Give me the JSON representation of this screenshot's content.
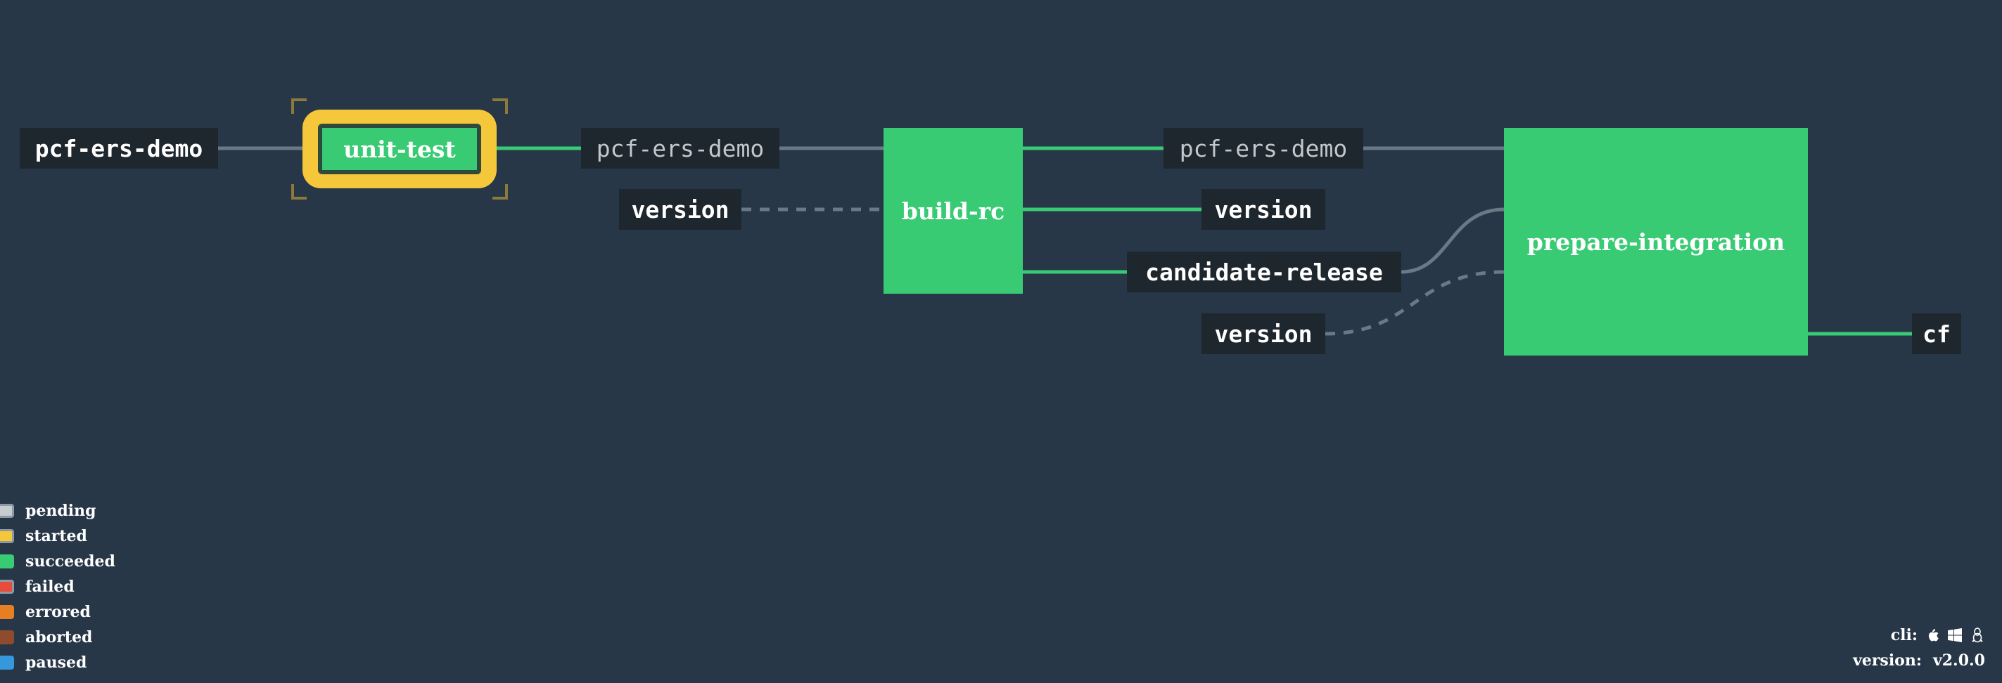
{
  "pipeline": {
    "resources": {
      "pcf_ers_demo_in": "pcf-ers-demo",
      "pcf_ers_demo_mid": "pcf-ers-demo",
      "version_mid": "version",
      "pcf_ers_demo_out": "pcf-ers-demo",
      "version_out": "version",
      "candidate_release": "candidate-release",
      "version_low": "version",
      "cf": "cf"
    },
    "jobs": {
      "unit_test": "unit-test",
      "build_rc": "build-rc",
      "prepare_integration": "prepare-integration"
    }
  },
  "legend": [
    {
      "label": "pending",
      "color": "#c7ccd1",
      "border": "#8d9aa6"
    },
    {
      "label": "started",
      "color": "#f5c73b",
      "border": "#8d9aa6"
    },
    {
      "label": "succeeded",
      "color": "#39ca74",
      "border": ""
    },
    {
      "label": "failed",
      "color": "#e74c3c",
      "border": "#8d9aa6"
    },
    {
      "label": "errored",
      "color": "#e67e22",
      "border": ""
    },
    {
      "label": "aborted",
      "color": "#8f4b2d",
      "border": ""
    },
    {
      "label": "paused",
      "color": "#3498db",
      "border": ""
    }
  ],
  "footer": {
    "cli_label": "cli:",
    "version_label": "version:",
    "version_value": "v2.0.0",
    "os_icons": [
      "apple-icon",
      "windows-icon",
      "linux-icon"
    ]
  },
  "colors": {
    "background": "#273747",
    "success": "#39ca74",
    "edge_gray": "#6b7886",
    "started": "#f5c73b"
  }
}
